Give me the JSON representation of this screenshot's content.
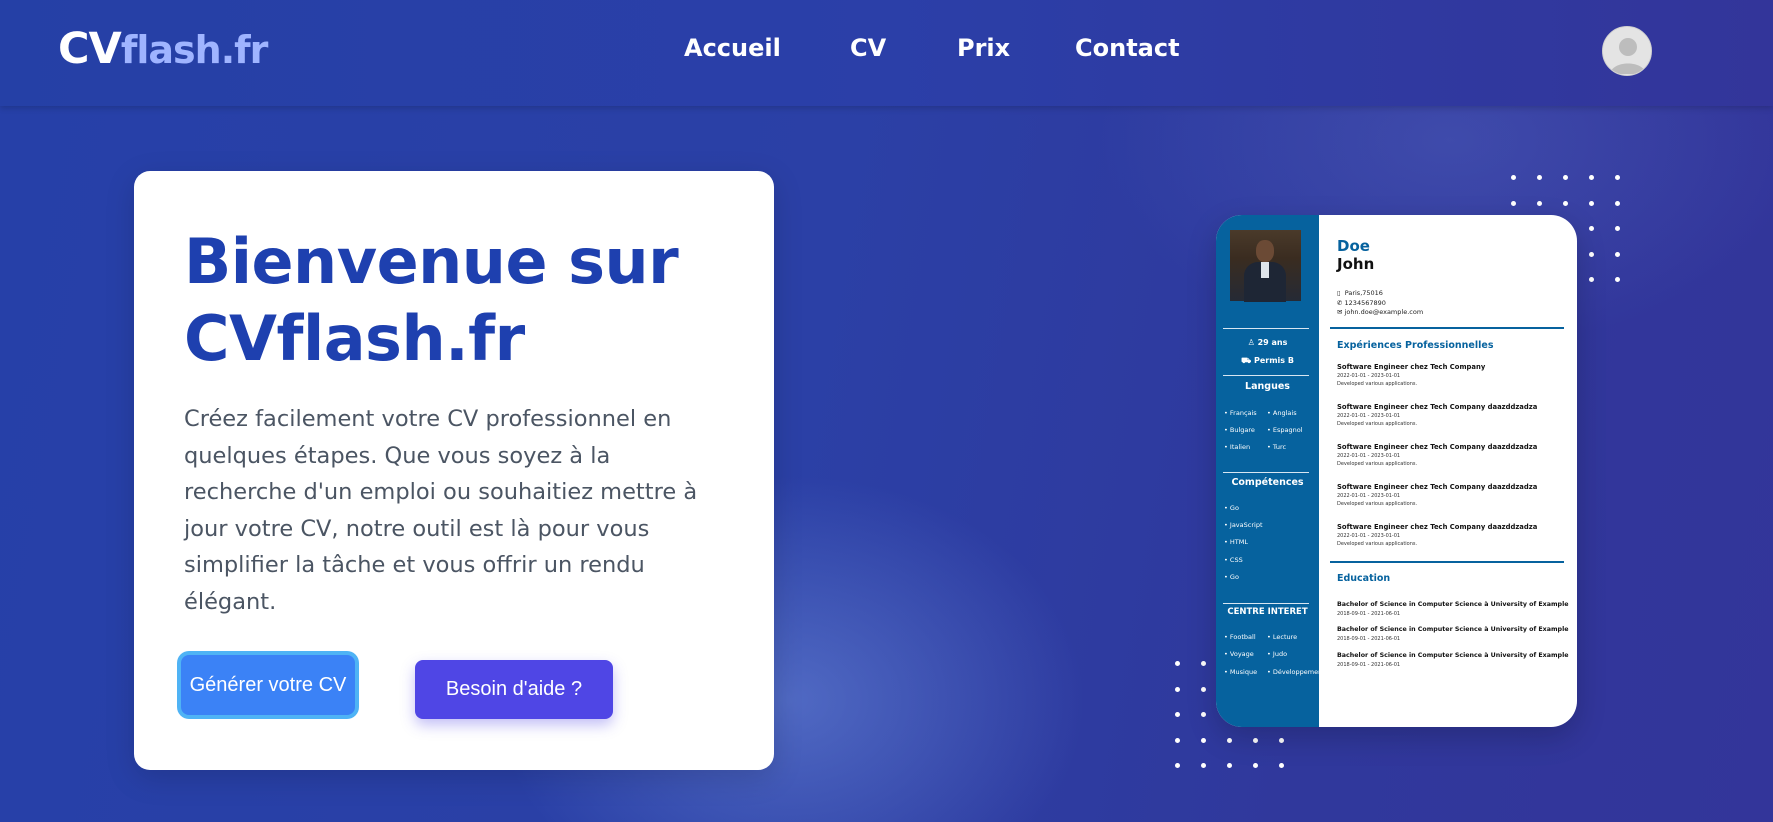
{
  "header": {
    "logo_main": "CV",
    "logo_sub": "flash.fr",
    "nav": [
      "Accueil",
      "CV",
      "Prix",
      "Contact"
    ],
    "avatar_icon": "user-avatar-icon"
  },
  "hero": {
    "title": "Bienvenue sur CVflash.fr",
    "description": "Créez facilement votre CV professionnel en quelques étapes. Que vous soyez à la recherche d'un emploi ou souhaitiez mettre à jour votre CV, notre outil est là pour vous simplifier la tâche et vous offrir un rendu élégant.",
    "button_generate": "Générer votre CV",
    "button_help": "Besoin d'aide ?"
  },
  "cv_preview": {
    "first_name": "Doe",
    "last_name": "John",
    "address": "Paris,75016",
    "phone": "1234567890",
    "email": "john.doe@example.com",
    "age": "29 ans",
    "license": "Permis B",
    "languages_title": "Langues",
    "languages": [
      "Français",
      "Anglais",
      "Bulgare",
      "Espagnol",
      "Italien",
      "Turc"
    ],
    "skills_title": "Compétences",
    "skills": [
      "Go",
      "JavaScript",
      "HTML",
      "CSS",
      "Go"
    ],
    "interests_title": "CENTRE INTERET",
    "interests": [
      "Football",
      "Lecture",
      "Voyage",
      "Judo",
      "Musique",
      "Développement"
    ],
    "experience_title": "Expériences Professionnelles",
    "experiences": [
      {
        "title": "Software Engineer chez Tech Company",
        "dates": "2022-01-01 - 2023-01-01",
        "desc": "Developed various applications."
      },
      {
        "title": "Software Engineer chez Tech Company daazddzadza",
        "dates": "2022-01-01 - 2023-01-01",
        "desc": "Developed various applications."
      },
      {
        "title": "Software Engineer chez Tech Company daazddzadza",
        "dates": "2022-01-01 - 2023-01-01",
        "desc": "Developed various applications."
      },
      {
        "title": "Software Engineer chez Tech Company daazddzadza",
        "dates": "2022-01-01 - 2023-01-01",
        "desc": "Developed various applications."
      },
      {
        "title": "Software Engineer chez Tech Company daazddzadza",
        "dates": "2022-01-01 - 2023-01-01",
        "desc": "Developed various applications."
      }
    ],
    "education_title": "Education",
    "education": [
      {
        "title": "Bachelor of Science in Computer Science à University of Example",
        "dates": "2018-09-01 - 2021-06-01"
      },
      {
        "title": "Bachelor of Science in Computer Science à University of Example",
        "dates": "2018-09-01 - 2021-06-01"
      },
      {
        "title": "Bachelor of Science in Computer Science à University of Example",
        "dates": "2018-09-01 - 2021-06-01"
      }
    ]
  },
  "colors": {
    "brand_blue": "#1e40af",
    "primary_button": "#3b82f6",
    "secondary_button": "#4f46e5",
    "cv_sidebar": "#06629e"
  }
}
